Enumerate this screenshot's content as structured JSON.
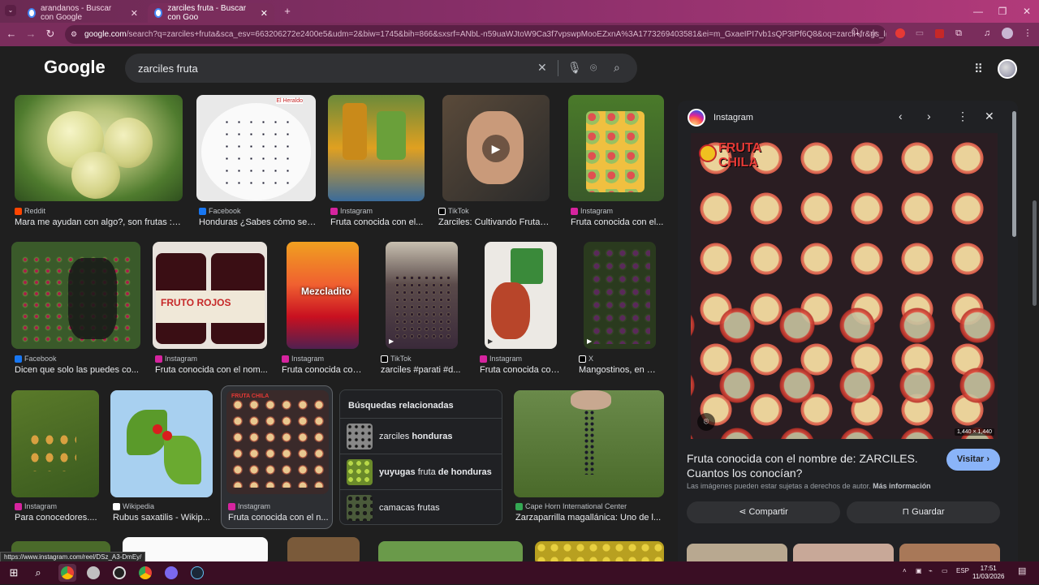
{
  "browser": {
    "tabs": [
      {
        "label": "arandanos - Buscar con Google",
        "active": false
      },
      {
        "label": "zarciles fruta - Buscar con Goo",
        "active": true
      }
    ],
    "url_host": "google.com",
    "url_rest": "/search?q=zarciles+fruta&sca_esv=663206272e2400e5&udm=2&biw=1745&bih=866&sxsrf=ANbL-n59uaWJtoW9Ca3f7vpswpMooEZxnA%3A1773269403581&ei=m_GxaeIPI7vb1sQP3tPf6Q8&oq=zarcil+fr&gs_lp="
  },
  "google": {
    "logo": "Google",
    "query": "zarciles fruta"
  },
  "results": [
    {
      "source": "Reddit",
      "caption": "Mara me ayudan con algo?, son frutas : r/...",
      "srccolor": "#ff4500"
    },
    {
      "source": "Facebook",
      "caption": "Honduras ¿Sabes cómo se ...",
      "srccolor": "#1877f2"
    },
    {
      "source": "Instagram",
      "caption": "Fruta conocida con el...",
      "srccolor": "#d6249f"
    },
    {
      "source": "TikTok",
      "caption": "Zarciles: Cultivando Frutas ...",
      "srccolor": "#ffffff"
    },
    {
      "source": "Instagram",
      "caption": "Fruta conocida con el...",
      "srccolor": "#d6249f"
    },
    {
      "source": "Facebook",
      "caption": "Dicen que solo las puedes co...",
      "srccolor": "#1877f2"
    },
    {
      "source": "Instagram",
      "caption": "Fruta conocida con el nom...",
      "srccolor": "#d6249f"
    },
    {
      "source": "Instagram",
      "caption": "Fruta conocida con...",
      "srccolor": "#d6249f",
      "overlay": "Mezcladito"
    },
    {
      "source": "TikTok",
      "caption": "zarciles #parati #d...",
      "srccolor": "#ffffff"
    },
    {
      "source": "Instagram",
      "caption": "Fruta conocida con...",
      "srccolor": "#d6249f"
    },
    {
      "source": "X",
      "caption": "Mangostinos, en H...",
      "srccolor": "#ffffff"
    },
    {
      "source": "Instagram",
      "caption": "Para conocedores....",
      "srccolor": "#d6249f"
    },
    {
      "source": "Wikipedia",
      "caption": "Rubus saxatilis - Wikip...",
      "srccolor": "#ffffff"
    },
    {
      "source": "Instagram",
      "caption": "Fruta conocida con el n...",
      "srccolor": "#d6249f"
    },
    {
      "source": "Cape Horn International Center",
      "caption": "Zarzaparrilla magallánica: Uno de l...",
      "srccolor": "#34a853"
    }
  ],
  "related": {
    "title": "Búsquedas relacionadas",
    "items": [
      {
        "plain": "zarciles ",
        "bold": "honduras",
        "tail": ""
      },
      {
        "plain": "",
        "bold": "yuyugas",
        "mid": " fruta ",
        "tail": "de honduras"
      },
      {
        "plain": "camacas frutas",
        "bold": "",
        "tail": ""
      }
    ]
  },
  "panel": {
    "source": "Instagram",
    "dims": "1,440 × 1,440",
    "image_text": "FRUTA CHILA",
    "title": "Fruta conocida con el nombre de: ZARCILES. Cuantos los conocían?",
    "visit": "Visitar",
    "copyright": "Las imágenes pueden estar sujetas a derechos de autor.",
    "more_info": "Más información",
    "share": "Compartir",
    "save": "Guardar"
  },
  "status_url": "https://www.instagram.com/reel/DSz_A3-DmEy/",
  "taskbar": {
    "lang": "ESP",
    "time": "17:51",
    "date": "11/03/2026"
  }
}
